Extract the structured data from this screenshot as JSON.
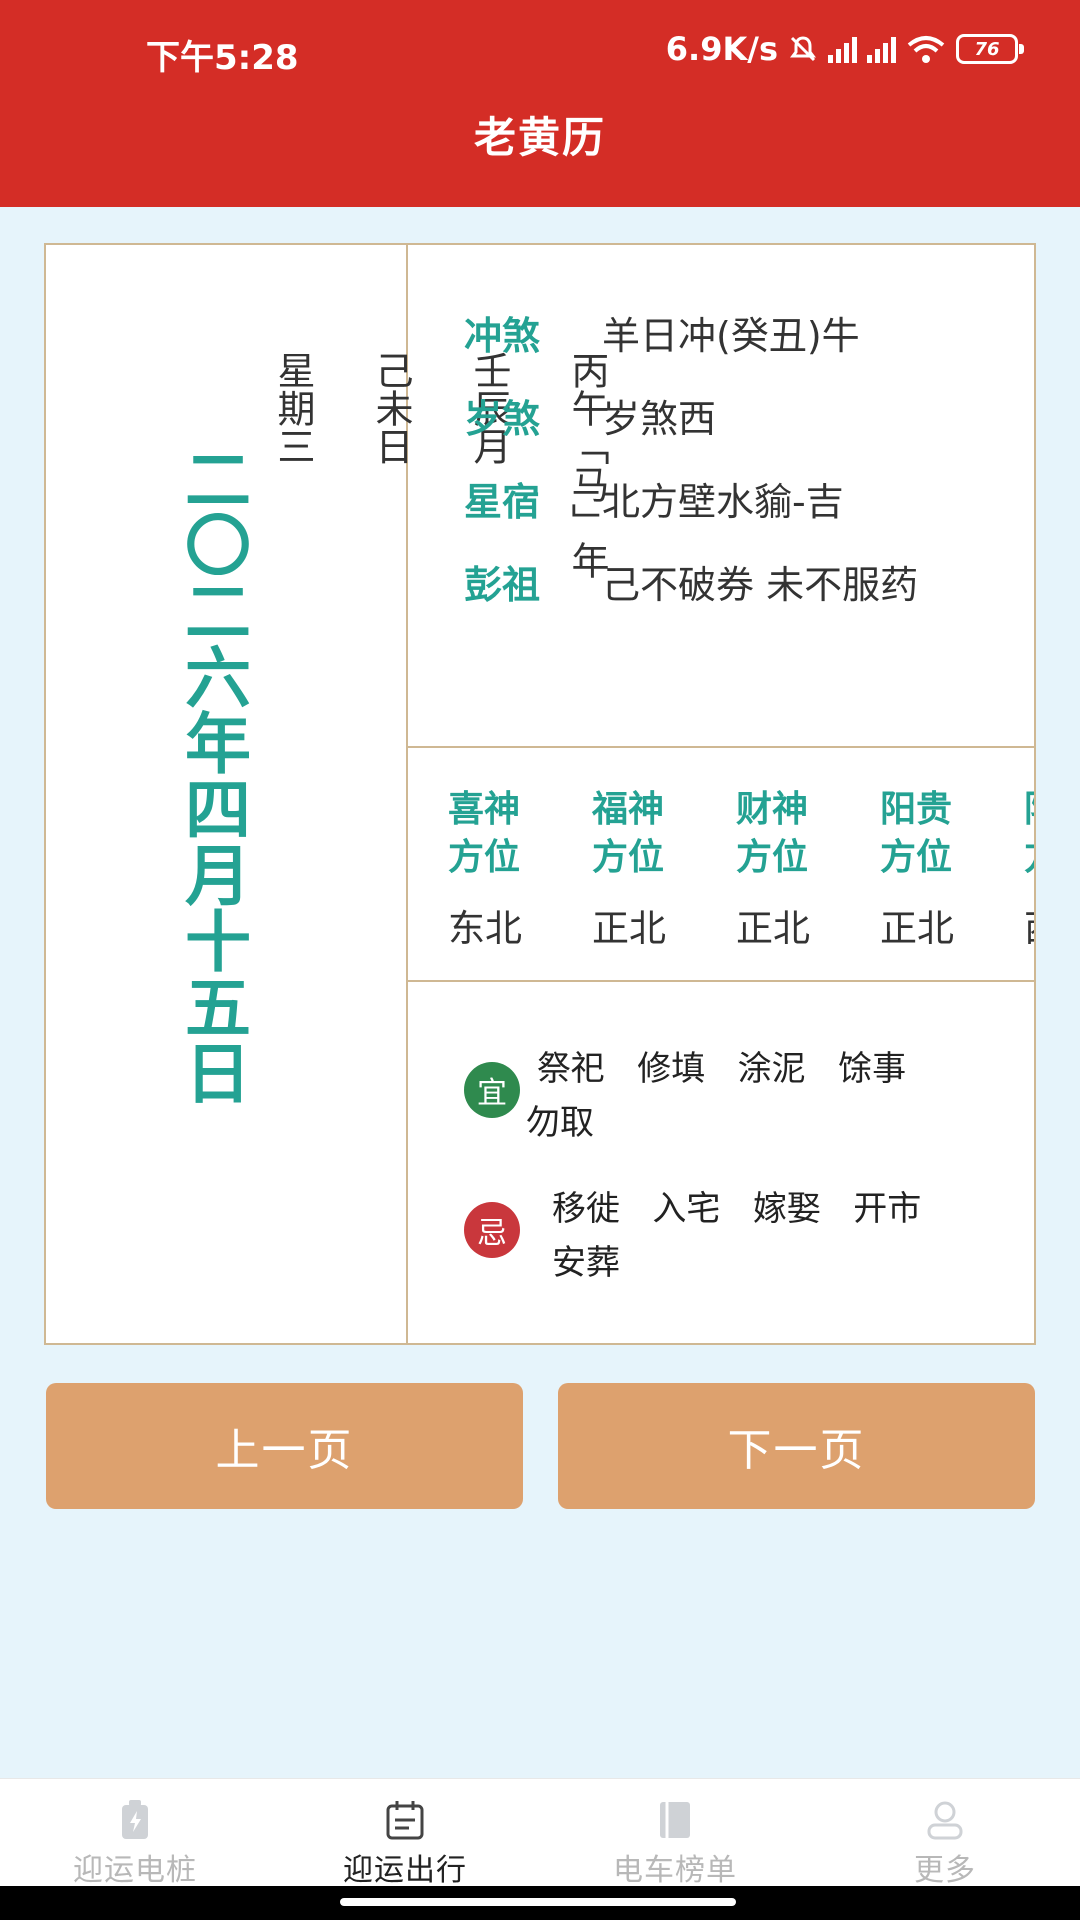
{
  "status": {
    "time": "下午5:28",
    "net_speed": "6.9K/s",
    "battery": "76"
  },
  "app": {
    "title": "老黄历"
  },
  "date": {
    "chinese_date": "二〇二六年四月十五日",
    "ganzhi": "丙午「马」年\n\n壬辰月\n\n己未日\n\n星期三"
  },
  "info": [
    {
      "key": "冲煞",
      "value": "羊日冲(癸丑)牛"
    },
    {
      "key": "岁煞",
      "value": "岁煞西"
    },
    {
      "key": "星宿",
      "value": "北方壁水貐-吉"
    },
    {
      "key": "彭祖",
      "value": "己不破券 未不服药"
    }
  ],
  "directions": [
    {
      "title": "喜神方位",
      "value": "东北"
    },
    {
      "title": "福神方位",
      "value": "正北"
    },
    {
      "title": "财神方位",
      "value": "正北"
    },
    {
      "title": "阳贵方位",
      "value": "正北"
    },
    {
      "title": "阴贵方位",
      "value": "西南"
    }
  ],
  "yi": {
    "badge": "宜",
    "text": " 祭祀   修填   涂泥   馀事\n勿取"
  },
  "ji": {
    "badge": "忌",
    "text": "移徙   入宅   嫁娶   开市\n安葬"
  },
  "buttons": {
    "prev": "上一页",
    "next": "下一页"
  },
  "nav": [
    {
      "label": "迎运电桩",
      "icon": "charging-pile-icon"
    },
    {
      "label": "迎运出行",
      "icon": "calendar-icon"
    },
    {
      "label": "电车榜单",
      "icon": "book-icon"
    },
    {
      "label": "更多",
      "icon": "user-icon"
    }
  ],
  "colors": {
    "header": "#d42d26",
    "accent": "#24a293",
    "button": "#dda16e",
    "yi": "#2f8a4e",
    "ji": "#c9373c",
    "background": "#e6f4fb"
  }
}
